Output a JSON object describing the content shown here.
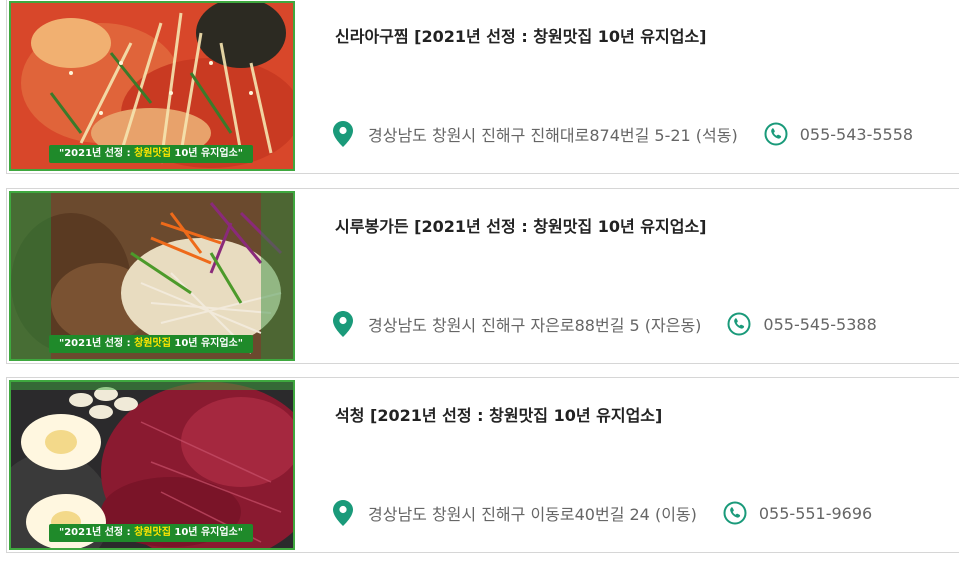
{
  "restaurants": [
    {
      "name": "신라아구찜 [2021년 선정 : 창원맛집 10년 유지업소]",
      "address": "경상남도 창원시 진해구 진해대로874번길 5-21 (석동)",
      "phone": "055-543-5558",
      "badge_prefix": "\"2021년 선정 : ",
      "badge_highlight": "창원맛집",
      "badge_suffix": " 10년 유지업소\""
    },
    {
      "name": "시루봉가든 [2021년 선정 : 창원맛집 10년 유지업소]",
      "address": "경상남도 창원시 진해구 자은로88번길 5 (자은동)",
      "phone": "055-545-5388",
      "badge_prefix": "\"2021년 선정 : ",
      "badge_highlight": "창원맛집",
      "badge_suffix": " 10년 유지업소\""
    },
    {
      "name": "석청 [2021년 선정 : 창원맛집 10년 유지업소]",
      "address": "경상남도 창원시 진해구 이동로40번길 24 (이동)",
      "phone": "055-551-9696",
      "badge_prefix": "\"2021년 선정 : ",
      "badge_highlight": "창원맛집",
      "badge_suffix": " 10년 유지업소\""
    }
  ],
  "colors": {
    "accent": "#1a9a7a",
    "border": "#d6d6d6",
    "badge_green": "#1f8a2a",
    "badge_highlight": "#ffe600"
  },
  "icons": {
    "address": "map-pin-icon",
    "phone": "phone-icon"
  }
}
